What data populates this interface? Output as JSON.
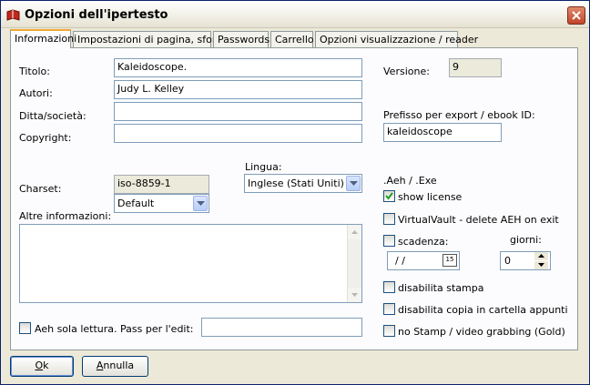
{
  "window": {
    "title": "Opzioni dell'ipertesto",
    "icon": "book-icon",
    "close_icon": "close-icon"
  },
  "tabs": [
    {
      "label": "Informazioni",
      "active": true
    },
    {
      "label": "Impostazioni di pagina, sfondo",
      "active": false
    },
    {
      "label": "Passwords",
      "active": false
    },
    {
      "label": "Carrello",
      "active": false
    },
    {
      "label": "Opzioni visualizzazione / reader",
      "active": false
    }
  ],
  "info": {
    "titolo_label": "Titolo:",
    "titolo_value": "Kaleidoscope.",
    "autori_label": "Autori:",
    "autori_value": "Judy L. Kelley",
    "ditta_label": "Ditta/società:",
    "ditta_value": "",
    "copyright_label": "Copyright:",
    "copyright_value": "",
    "versione_label": "Versione:",
    "versione_value": "9",
    "prefisso_label": "Prefisso per export / ebook ID:",
    "prefisso_value": "kaleidoscope",
    "charset_label": "Charset:",
    "charset_value": "iso-8859-1",
    "charset_combo_value": "Default",
    "lingua_label": "Lingua:",
    "lingua_value": "Inglese (Stati Uniti)",
    "altre_label": "Altre informazioni:",
    "altre_value": "",
    "readonly_label": "Aeh sola lettura. Pass per l'edit:",
    "readonly_checked": false,
    "readonly_pass": ""
  },
  "aeh": {
    "section_label": ".Aeh / .Exe",
    "show_license_label": "show license",
    "show_license_checked": true,
    "virtualvault_label": "VirtualVault - delete AEH on exit",
    "virtualvault_checked": false,
    "scadenza_label": "scadenza:",
    "scadenza_checked": false,
    "scadenza_date": "/ /",
    "calendar_day": "15",
    "giorni_label": "giorni:",
    "giorni_value": "0",
    "disabilita_stampa_label": "disabilita stampa",
    "disabilita_stampa_checked": false,
    "disabilita_copia_label": "disabilita copia in cartella appunti",
    "disabilita_copia_checked": false,
    "no_stamp_label": "no Stamp / video grabbing (Gold)",
    "no_stamp_checked": false
  },
  "buttons": {
    "ok_hotkey": "O",
    "ok_rest": "k",
    "annulla_hotkey": "A",
    "annulla_rest": "nnulla"
  },
  "colors": {
    "active_tab_accent": "#f4a833",
    "close_button": "#c1442a",
    "check_mark": "#21a121"
  }
}
